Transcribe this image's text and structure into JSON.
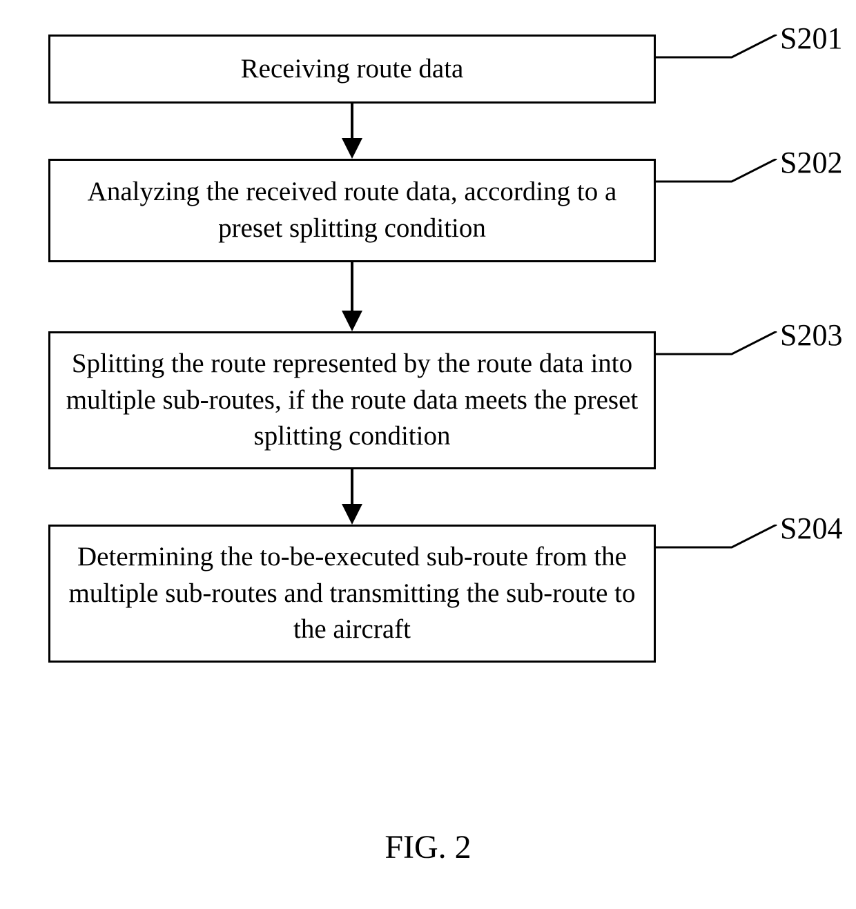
{
  "diagram": {
    "steps": [
      {
        "label": "S201",
        "text": "Receiving route data"
      },
      {
        "label": "S202",
        "text": "Analyzing the received route data, according to a preset splitting condition"
      },
      {
        "label": "S203",
        "text": "Splitting the route represented by the route data into multiple sub-routes, if the route data meets the preset splitting condition"
      },
      {
        "label": "S204",
        "text": "Determining the to-be-executed sub-route from the multiple sub-routes and transmitting the sub-route to the aircraft"
      }
    ],
    "figure_caption": "FIG. 2"
  }
}
